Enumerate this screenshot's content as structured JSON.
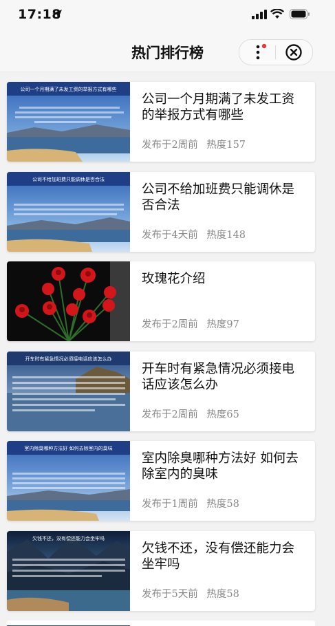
{
  "status_bar": {
    "time": "17:18"
  },
  "nav": {
    "title": "热门排行榜"
  },
  "articles": [
    {
      "title": "公司一个月期满了未发工资的举报方式有哪些",
      "thumb_heading": "公司一个月期满了未发工资的举报方式有哪些",
      "published": "发布于2周前",
      "heat": "热度157"
    },
    {
      "title": "公司不给加班费只能调休是否合法",
      "thumb_heading": "公司不给加班费只能调休是否合法",
      "published": "发布于4天前",
      "heat": "热度148"
    },
    {
      "title": "玫瑰花介绍",
      "thumb_heading": "",
      "published": "发布于2周前",
      "heat": "热度97"
    },
    {
      "title": "开车时有紧急情况必须接电话应该怎么办",
      "thumb_heading": "开车时有紧急情况必须接电话应该怎么办",
      "published": "发布于2周前",
      "heat": "热度65"
    },
    {
      "title": "室内除臭哪种方法好 如何去除室内的臭味",
      "thumb_heading": "室内除臭哪种方法好 如何去除室内的臭味",
      "published": "发布于1周前",
      "heat": "热度58"
    },
    {
      "title": "欠钱不还，没有偿还能力会坐牢吗",
      "thumb_heading": "欠钱不还，没有偿还能力会坐牢吗",
      "published": "发布于5天前",
      "heat": "热度58"
    }
  ]
}
